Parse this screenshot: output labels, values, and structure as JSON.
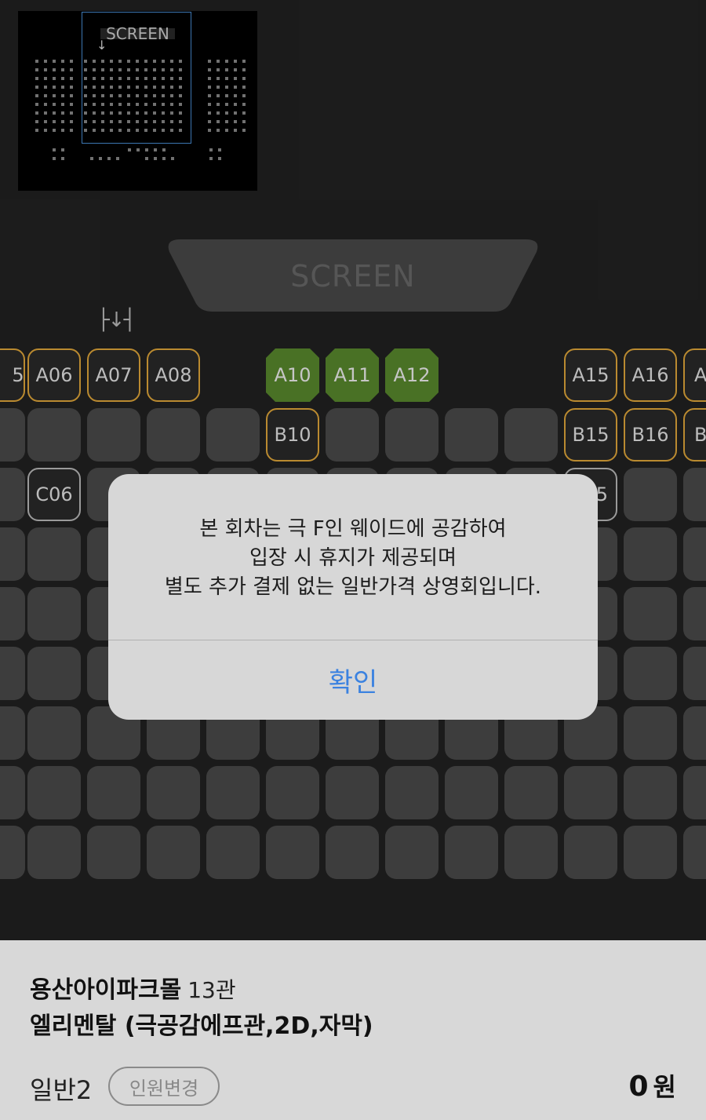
{
  "minimap": {
    "screen_label": "SCREEN",
    "arrow": "↓"
  },
  "screen": {
    "label": "SCREEN"
  },
  "handicap_marker": "├↓┤",
  "seats": {
    "row_a": [
      "5",
      "A06",
      "A07",
      "A08",
      "A10",
      "A11",
      "A12",
      "A15",
      "A16",
      "A"
    ],
    "row_b": [
      "B10",
      "B15",
      "B16",
      "B"
    ],
    "row_c": [
      "C06",
      "5"
    ]
  },
  "dialog": {
    "lines": [
      "본 회차는 극 F인 웨이드에 공감하여",
      "입장 시 휴지가 제공되며",
      "별도 추가 결제 없는 일반가격 상영회입니다."
    ],
    "confirm_label": "확인"
  },
  "bottom": {
    "cinema": "용산아이파크몰",
    "hall": "13관",
    "movie": "엘리멘탈 (극공감에프관,2D,자막)",
    "person_type": "일반2",
    "change_label": "인원변경",
    "price": "0",
    "price_unit": "원"
  },
  "colors": {
    "background": "#222222",
    "seat_available": "#4b4b4b",
    "seat_selected_green": "#5a8a2e",
    "seat_border_yellow": "#e3a93b",
    "accent_blue": "#3b82e0"
  }
}
